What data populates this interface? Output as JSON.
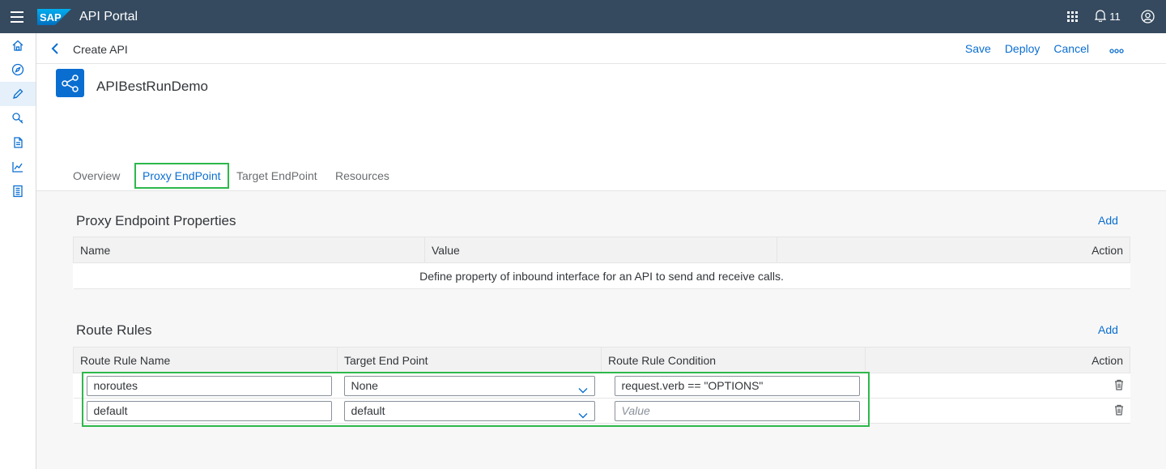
{
  "shell": {
    "title": "API Portal",
    "notification_count": "11"
  },
  "toolbar": {
    "page_title": "Create API",
    "save_label": "Save",
    "deploy_label": "Deploy",
    "cancel_label": "Cancel"
  },
  "object": {
    "title": "APIBestRunDemo"
  },
  "tabs": [
    {
      "label": "Overview"
    },
    {
      "label": "Proxy EndPoint"
    },
    {
      "label": "Target EndPoint"
    },
    {
      "label": "Resources"
    }
  ],
  "proxy_props": {
    "title": "Proxy Endpoint Properties",
    "add_label": "Add",
    "columns": [
      "Name",
      "Value",
      "Action"
    ],
    "empty_text": "Define property of inbound interface for an API to send and receive calls."
  },
  "route_rules": {
    "title": "Route Rules",
    "add_label": "Add",
    "columns": [
      "Route Rule Name",
      "Target End Point",
      "Route Rule Condition",
      "Action"
    ],
    "rows": [
      {
        "name": "noroutes",
        "target": "None",
        "condition": "request.verb == \"OPTIONS\"",
        "condition_placeholder": ""
      },
      {
        "name": "default",
        "target": "default",
        "condition": "",
        "condition_placeholder": "Value"
      }
    ]
  },
  "colors": {
    "shell_bg": "#354a5f",
    "accent": "#0a6ed1",
    "highlight": "#2eb84b"
  }
}
